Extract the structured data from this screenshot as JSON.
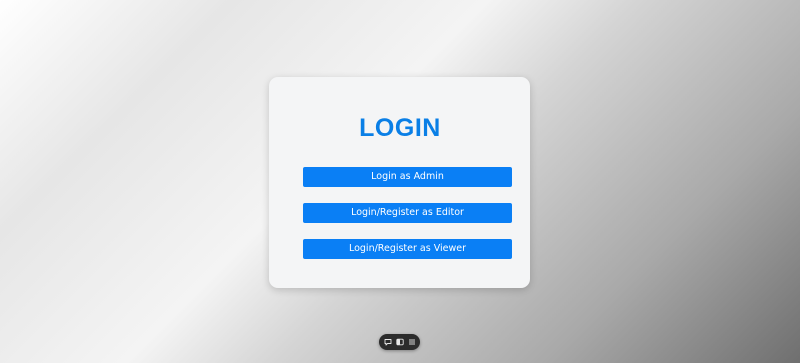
{
  "login": {
    "title": "LOGIN",
    "buttons": {
      "admin": "Login as Admin",
      "editor": "Login/Register as Editor",
      "viewer": "Login/Register as Viewer"
    }
  },
  "colors": {
    "accent": "#0a7ff5",
    "title": "#0a7fe6",
    "card": "#f4f5f6",
    "toolbar": "#2c2c2c"
  },
  "toolbar": {
    "icons": [
      "comment-icon",
      "toggle-icon",
      "menu-icon"
    ]
  }
}
